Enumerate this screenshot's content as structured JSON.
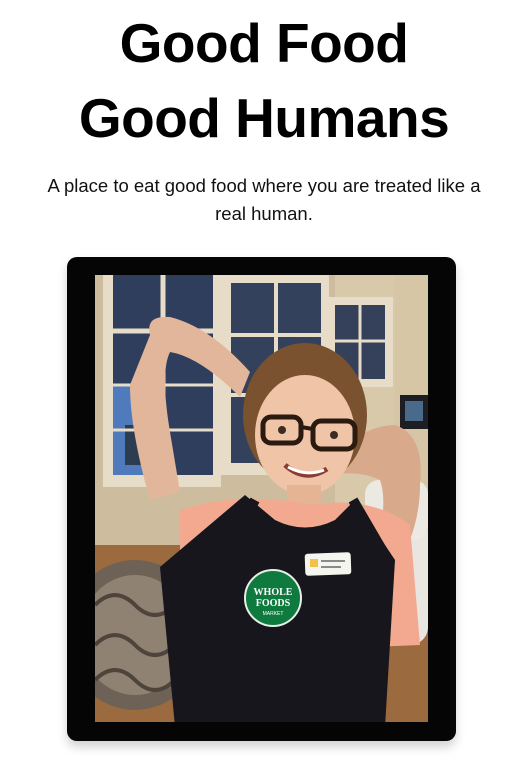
{
  "hero": {
    "title_line1": "Good Food",
    "title_line2": "Good Humans",
    "subtitle": "A place to eat good food where you are treated like a real human."
  },
  "photo": {
    "badge_line1": "WHOLE",
    "badge_line2": "FOODS",
    "badge_line3": "MARKET",
    "colors": {
      "frame": "#050505",
      "apron": "#16161c",
      "badge": "#0f7a3e"
    }
  }
}
